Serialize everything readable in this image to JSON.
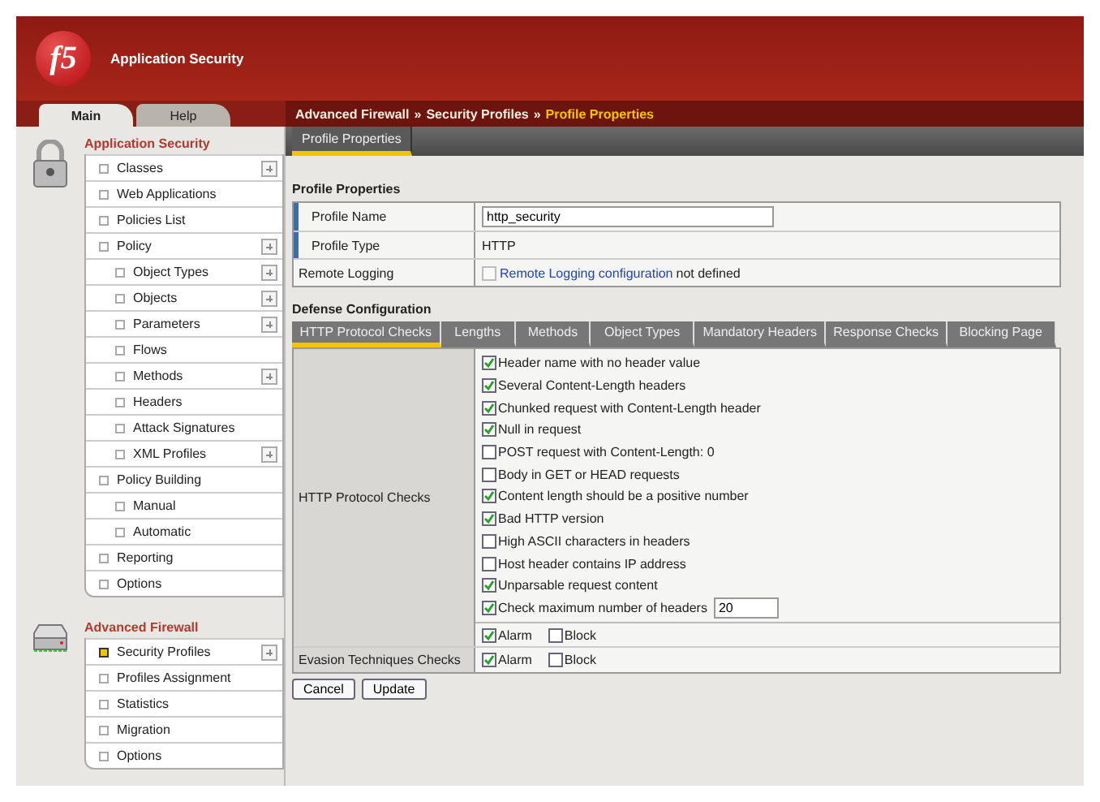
{
  "header": {
    "logo": "f5",
    "title": "Application Security"
  },
  "main_tabs": [
    {
      "label": "Main",
      "selected": true
    },
    {
      "label": "Help",
      "selected": false
    }
  ],
  "breadcrumb": {
    "separator": "»",
    "items": [
      {
        "label": "Advanced Firewall",
        "current": false
      },
      {
        "label": "Security Profiles",
        "current": false
      },
      {
        "label": "Profile Properties",
        "current": true
      }
    ]
  },
  "sub_tabs": [
    {
      "label": "Profile Properties",
      "selected": true
    }
  ],
  "sidebar": {
    "sections": [
      {
        "title": "Application Security",
        "items": [
          {
            "label": "Classes",
            "expandable": true,
            "selected": false
          },
          {
            "label": "Web Applications",
            "expandable": false,
            "selected": false
          },
          {
            "label": "Policies List",
            "expandable": false,
            "selected": false
          },
          {
            "label": "Policy",
            "expandable": true,
            "selected": false,
            "children": [
              {
                "label": "Object Types",
                "expandable": true,
                "selected": false
              },
              {
                "label": "Objects",
                "expandable": true,
                "selected": false
              },
              {
                "label": "Parameters",
                "expandable": true,
                "selected": false
              },
              {
                "label": "Flows",
                "expandable": false,
                "selected": false
              },
              {
                "label": "Methods",
                "expandable": true,
                "selected": false
              },
              {
                "label": "Headers",
                "expandable": false,
                "selected": false
              },
              {
                "label": "Attack Signatures",
                "expandable": false,
                "selected": false
              },
              {
                "label": "XML Profiles",
                "expandable": true,
                "selected": false
              }
            ]
          },
          {
            "label": "Policy Building",
            "expandable": false,
            "selected": false,
            "children": [
              {
                "label": "Manual",
                "expandable": false,
                "selected": false
              },
              {
                "label": "Automatic",
                "expandable": false,
                "selected": false
              }
            ]
          },
          {
            "label": "Reporting",
            "expandable": false,
            "selected": false
          },
          {
            "label": "Options",
            "expandable": false,
            "selected": false
          }
        ]
      },
      {
        "title": "Advanced Firewall",
        "items": [
          {
            "label": "Security Profiles",
            "expandable": true,
            "selected": true
          },
          {
            "label": "Profiles Assignment",
            "expandable": false,
            "selected": false
          },
          {
            "label": "Statistics",
            "expandable": false,
            "selected": false
          },
          {
            "label": "Migration",
            "expandable": false,
            "selected": false
          },
          {
            "label": "Options",
            "expandable": false,
            "selected": false
          }
        ]
      }
    ]
  },
  "profile_properties": {
    "title": "Profile Properties",
    "rows": [
      {
        "label": "Profile Name",
        "kind": "input",
        "required": true,
        "value": "http_security"
      },
      {
        "label": "Profile Type",
        "kind": "text",
        "required": true,
        "value": "HTTP"
      },
      {
        "label": "Remote Logging",
        "kind": "link",
        "required": false,
        "checked": false,
        "link": "Remote Logging configuration",
        "value": "not defined"
      }
    ]
  },
  "defense": {
    "title": "Defense Configuration",
    "tabs": [
      {
        "label": "HTTP Protocol Checks",
        "selected": true
      },
      {
        "label": "Lengths",
        "selected": false
      },
      {
        "label": "Methods",
        "selected": false
      },
      {
        "label": "Object Types",
        "selected": false
      },
      {
        "label": "Mandatory Headers",
        "selected": false
      },
      {
        "label": "Response Checks",
        "selected": false
      },
      {
        "label": "Blocking Page",
        "selected": false
      }
    ],
    "rows": [
      {
        "label": "HTTP Protocol Checks",
        "checks": [
          {
            "label": "Header name with no header value",
            "checked": true
          },
          {
            "label": "Several Content-Length headers",
            "checked": true
          },
          {
            "label": "Chunked request with Content-Length header",
            "checked": true
          },
          {
            "label": "Null in request",
            "checked": true
          },
          {
            "label": "POST request with Content-Length: 0",
            "checked": false
          },
          {
            "label": "Body in GET or HEAD requests",
            "checked": false
          },
          {
            "label": "Content length should be a positive number",
            "checked": true
          },
          {
            "label": "Bad HTTP version",
            "checked": true
          },
          {
            "label": "High ASCII characters in headers",
            "checked": false
          },
          {
            "label": "Host header contains IP address",
            "checked": false
          },
          {
            "label": "Unparsable request content",
            "checked": true
          },
          {
            "label": "Check maximum number of headers",
            "checked": true,
            "value": "20"
          }
        ],
        "actions": [
          {
            "label": "Alarm",
            "checked": true
          },
          {
            "label": "Block",
            "checked": false
          }
        ]
      },
      {
        "label": "Evasion Techniques Checks",
        "actions": [
          {
            "label": "Alarm",
            "checked": true
          },
          {
            "label": "Block",
            "checked": false
          }
        ]
      }
    ]
  },
  "buttons": [
    "Cancel",
    "Update"
  ]
}
